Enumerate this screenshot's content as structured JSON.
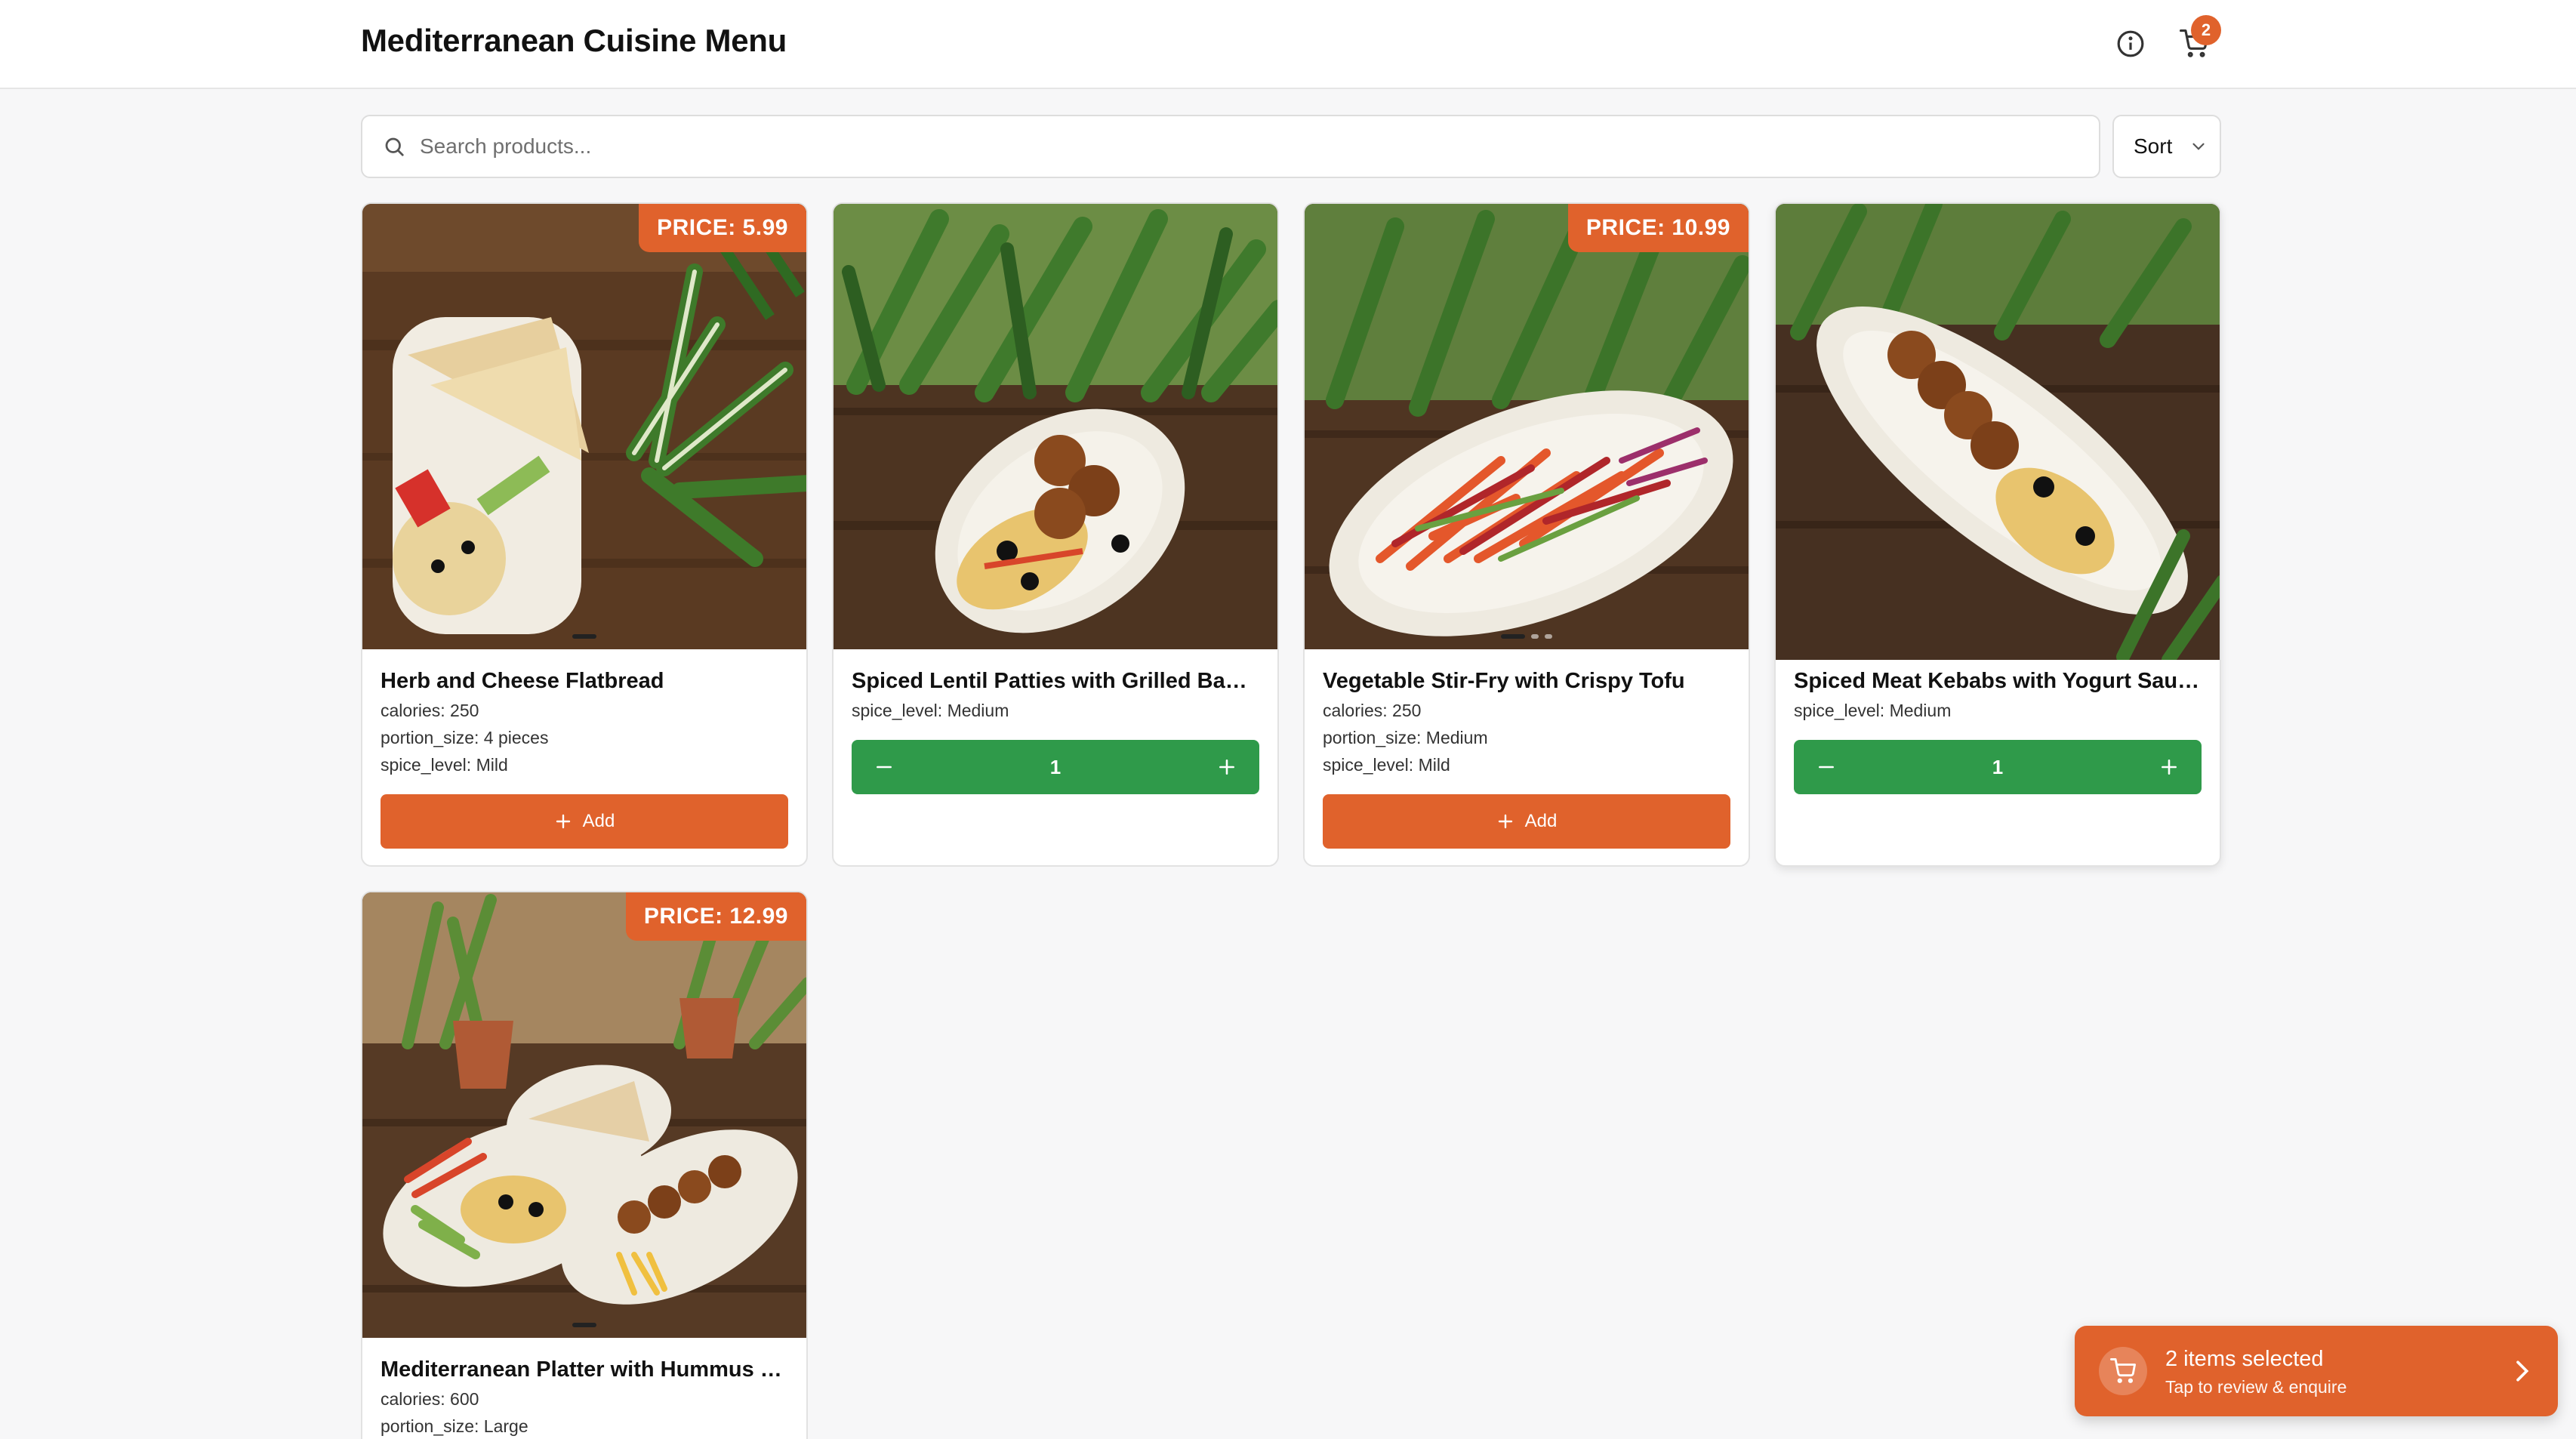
{
  "header": {
    "title": "Mediterranean Cuisine Menu",
    "cart_count": "2"
  },
  "search": {
    "placeholder": "Search products..."
  },
  "sort": {
    "label": "Sort"
  },
  "products": [
    {
      "name": "Herb and Cheese Flatbread",
      "price": "PRICE: 5.99",
      "attributes": [
        "calories: 250",
        "portion_size: 4 pieces",
        "spice_level: Mild"
      ],
      "action": "Add"
    },
    {
      "name": "Spiced Lentil Patties with Grilled Banana",
      "attributes": [
        "spice_level: Medium"
      ],
      "quantity": "1"
    },
    {
      "name": "Vegetable Stir-Fry with Crispy Tofu",
      "price": "PRICE: 10.99",
      "attributes": [
        "calories: 250",
        "portion_size: Medium",
        "spice_level: Mild"
      ],
      "action": "Add"
    },
    {
      "name": "Spiced Meat Kebabs with Yogurt Sauce",
      "attributes": [
        "spice_level: Medium"
      ],
      "quantity": "1"
    },
    {
      "name": "Mediterranean Platter with Hummus and Falafel",
      "price": "PRICE: 12.99",
      "attributes": [
        "calories: 600",
        "portion_size: Large"
      ]
    }
  ],
  "cart_summary": {
    "title": "2 items selected",
    "subtitle": "Tap to review & enquire"
  },
  "colors": {
    "accent": "#e0622c",
    "quantity_green": "#2f9a4a"
  }
}
